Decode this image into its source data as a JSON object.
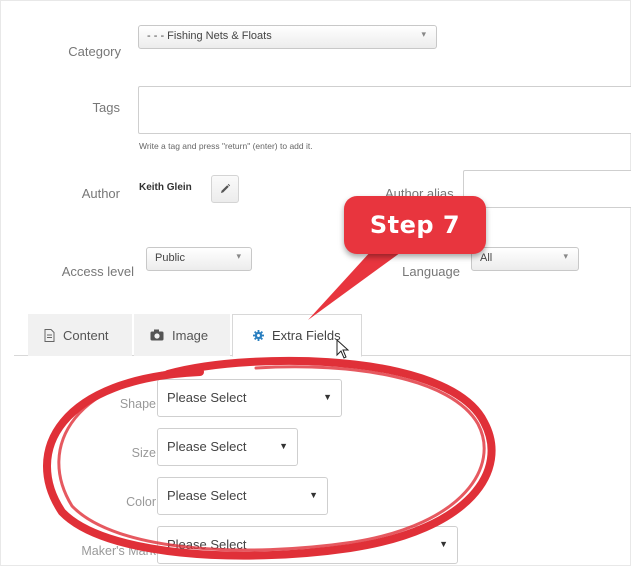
{
  "form": {
    "category": {
      "label": "Category",
      "value": "- - - Fishing Nets & Floats"
    },
    "tags": {
      "label": "Tags",
      "help": "Write a tag and press \"return\" (enter) to add it."
    },
    "author": {
      "label": "Author",
      "name": "Keith Glein",
      "alias_label": "Author alias"
    },
    "access": {
      "label": "Access level",
      "value": "Public"
    },
    "language": {
      "label": "Language",
      "value": "All"
    }
  },
  "tabs": [
    {
      "label": "Content",
      "icon": "document-icon",
      "active": false
    },
    {
      "label": "Image",
      "icon": "camera-icon",
      "active": false
    },
    {
      "label": "Extra Fields",
      "icon": "gear-icon",
      "active": true
    }
  ],
  "extra_fields": [
    {
      "label": "Shape",
      "value": "Please Select"
    },
    {
      "label": "Size",
      "value": "Please Select"
    },
    {
      "label": "Color",
      "value": "Please Select"
    },
    {
      "label": "Maker's Mark",
      "value": "Please Select"
    }
  ],
  "annotation": {
    "text": "Step 7",
    "color": "#e8353e",
    "ellipse_color": "#e03038"
  }
}
